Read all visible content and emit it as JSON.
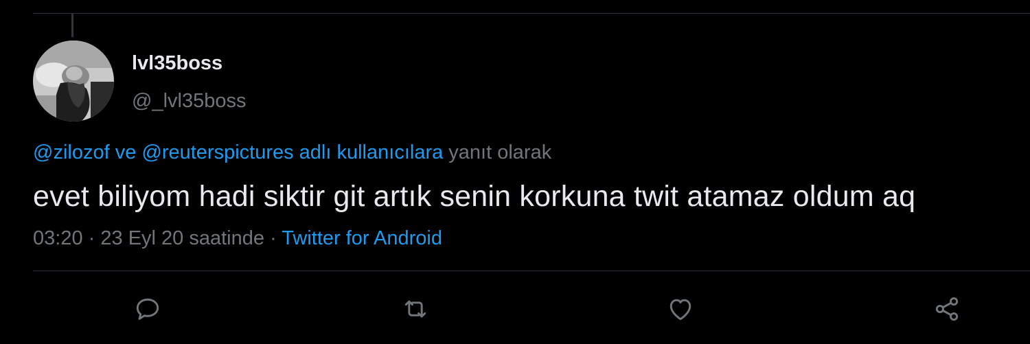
{
  "user": {
    "display_name": "lvl35boss",
    "handle": "@_lvl35boss"
  },
  "reply_to": {
    "mentions": "@zilozof ve @reuterspictures adlı kullanıcılara",
    "suffix": "yanıt olarak"
  },
  "tweet": {
    "text": "evet biliyom hadi siktir git artık senin korkuna twit atamaz oldum aq",
    "time": "03:20",
    "separator": "·",
    "date": "23 Eyl 20 saatinde",
    "source": "Twitter for Android"
  },
  "actions": [
    {
      "icon": "reply-icon"
    },
    {
      "icon": "retweet-icon"
    },
    {
      "icon": "like-icon"
    },
    {
      "icon": "share-icon"
    }
  ],
  "colors": {
    "background": "#000000",
    "text": "#e7e9ea",
    "secondary": "#71767b",
    "link": "#1d9bf0",
    "divider": "#2f3336"
  }
}
